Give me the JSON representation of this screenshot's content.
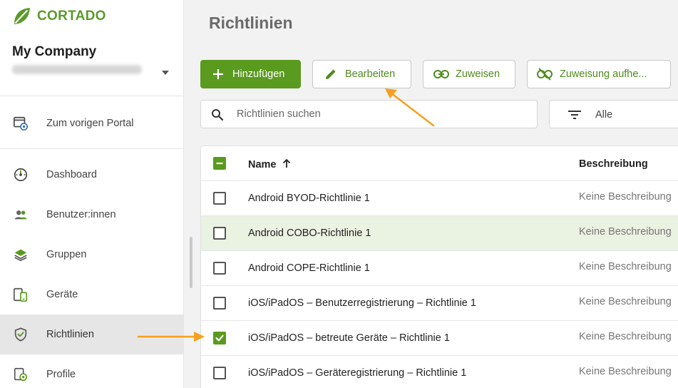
{
  "brand": {
    "name": "CORTADO",
    "color": "#5a9a2b"
  },
  "company": {
    "name": "My Company"
  },
  "sidebar": {
    "items": [
      {
        "label": "Zum vorigen Portal",
        "icon": "portal-back-icon"
      },
      {
        "label": "Dashboard",
        "icon": "dashboard-gauge-icon"
      },
      {
        "label": "Benutzer:innen",
        "icon": "users-icon"
      },
      {
        "label": "Gruppen",
        "icon": "layers-icon"
      },
      {
        "label": "Geräte",
        "icon": "devices-icon"
      },
      {
        "label": "Richtlinien",
        "icon": "shield-check-icon",
        "active": true
      },
      {
        "label": "Profile",
        "icon": "profile-settings-icon"
      }
    ]
  },
  "main": {
    "title": "Richtlinien",
    "toolbar": {
      "add_label": "Hinzufügen",
      "edit_label": "Bearbeiten",
      "assign_label": "Zuweisen",
      "unassign_label": "Zuweisung aufhe..."
    },
    "search": {
      "placeholder": "Richtlinien suchen"
    },
    "filter": {
      "label": "Alle"
    },
    "table": {
      "columns": {
        "name": "Name",
        "description": "Beschreibung"
      },
      "rows": [
        {
          "name": "Android BYOD-Richtlinie 1",
          "description": "Keine Beschreibung",
          "checked": false
        },
        {
          "name": "Android COBO-Richtlinie 1",
          "description": "Keine Beschreibung",
          "checked": false,
          "highlighted": true
        },
        {
          "name": "Android COPE-Richtlinie 1",
          "description": "Keine Beschreibung",
          "checked": false
        },
        {
          "name": "iOS/iPadOS – Benutzerregistrierung – Richtlinie 1",
          "description": "Keine Beschreibung",
          "checked": false
        },
        {
          "name": "iOS/iPadOS – betreute Geräte – Richtlinie 1",
          "description": "Keine Beschreibung",
          "checked": true
        },
        {
          "name": "iOS/iPadOS – Geräteregistrierung – Richtlinie 1",
          "description": "Keine Beschreibung",
          "checked": false
        }
      ]
    }
  },
  "colors": {
    "accent": "#5a9a1e",
    "annotation_arrow": "#f5a01f"
  }
}
